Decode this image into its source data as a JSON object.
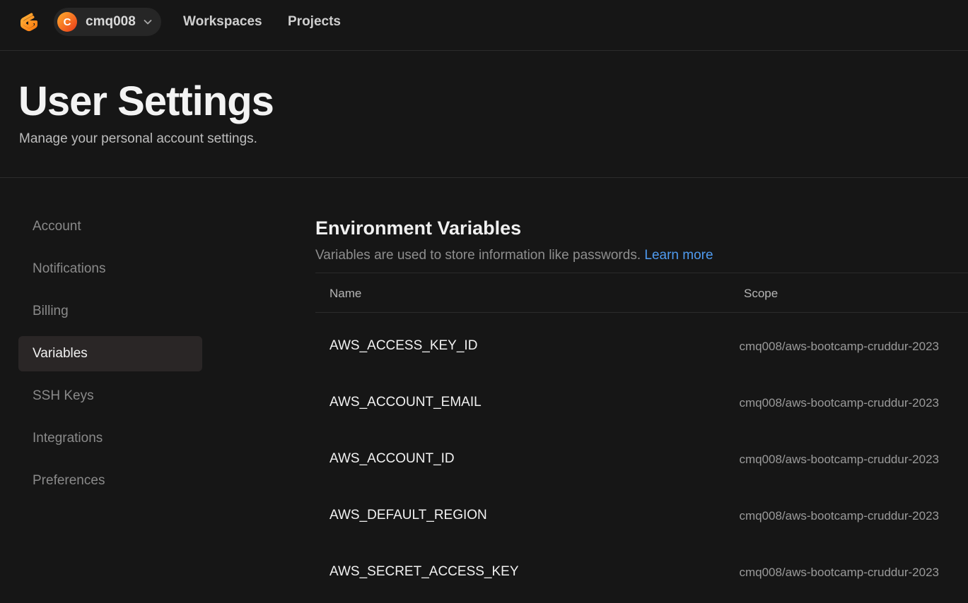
{
  "topbar": {
    "logo_icon": "gitpod-logo-icon",
    "user": {
      "avatar_letter": "C",
      "username": "cmq008"
    },
    "nav": [
      "Workspaces",
      "Projects"
    ]
  },
  "header": {
    "title": "User Settings",
    "subtitle": "Manage your personal account settings."
  },
  "sidebar": {
    "items": [
      {
        "label": "Account",
        "active": false
      },
      {
        "label": "Notifications",
        "active": false
      },
      {
        "label": "Billing",
        "active": false
      },
      {
        "label": "Variables",
        "active": true
      },
      {
        "label": "SSH Keys",
        "active": false
      },
      {
        "label": "Integrations",
        "active": false
      },
      {
        "label": "Preferences",
        "active": false
      }
    ]
  },
  "main": {
    "title": "Environment Variables",
    "description": "Variables are used to store information like passwords.",
    "learn_more": "Learn more",
    "columns": {
      "name": "Name",
      "scope": "Scope"
    },
    "rows": [
      {
        "name": "AWS_ACCESS_KEY_ID",
        "scope": "cmq008/aws-bootcamp-cruddur-2023"
      },
      {
        "name": "AWS_ACCOUNT_EMAIL",
        "scope": "cmq008/aws-bootcamp-cruddur-2023"
      },
      {
        "name": "AWS_ACCOUNT_ID",
        "scope": "cmq008/aws-bootcamp-cruddur-2023"
      },
      {
        "name": "AWS_DEFAULT_REGION",
        "scope": "cmq008/aws-bootcamp-cruddur-2023"
      },
      {
        "name": "AWS_SECRET_ACCESS_KEY",
        "scope": "cmq008/aws-bootcamp-cruddur-2023"
      }
    ]
  },
  "colors": {
    "background": "#161616",
    "accent_link": "#4f9bf0",
    "logo_orange": "#ff9a1f"
  }
}
